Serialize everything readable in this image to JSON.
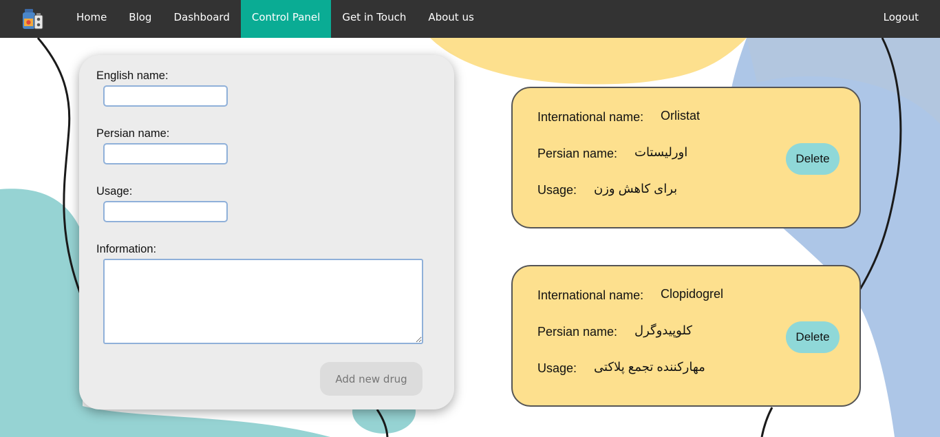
{
  "nav": {
    "items": [
      {
        "label": "Home"
      },
      {
        "label": "Blog"
      },
      {
        "label": "Dashboard"
      },
      {
        "label": "Control Panel"
      },
      {
        "label": "Get in Touch"
      },
      {
        "label": "About us"
      }
    ],
    "active_index": 3,
    "logout_label": "Logout",
    "logo_icon": "pharmacy-bottles-icon"
  },
  "form": {
    "english_name_label": "English name:",
    "persian_name_label": "Persian name:",
    "usage_label": "Usage:",
    "information_label": "Information:",
    "english_name_value": "",
    "persian_name_value": "",
    "usage_value": "",
    "information_value": "",
    "submit_label": "Add new drug"
  },
  "drugs": [
    {
      "international_label": "International name:",
      "international_name": "Orlistat",
      "persian_label": "Persian name:",
      "persian_name": "اورلیستات",
      "usage_label": "Usage:",
      "usage": "برای کاهش وزن",
      "delete_label": "Delete"
    },
    {
      "international_label": "International name:",
      "international_name": "Clopidogrel",
      "persian_label": "Persian name:",
      "persian_name": "کلوپیدوگرل",
      "usage_label": "Usage:",
      "usage": "مهارکننده تجمع پلاکتی",
      "delete_label": "Delete"
    }
  ],
  "colors": {
    "navbar": "#333333",
    "active_tab": "#0aac94",
    "card": "#fde08e",
    "delete_button": "#8fd8d8",
    "form_panel": "#ececec",
    "blob_teal": "#96d3d3",
    "blob_yellow": "#fde08e",
    "blob_blue": "#adc6e7"
  }
}
